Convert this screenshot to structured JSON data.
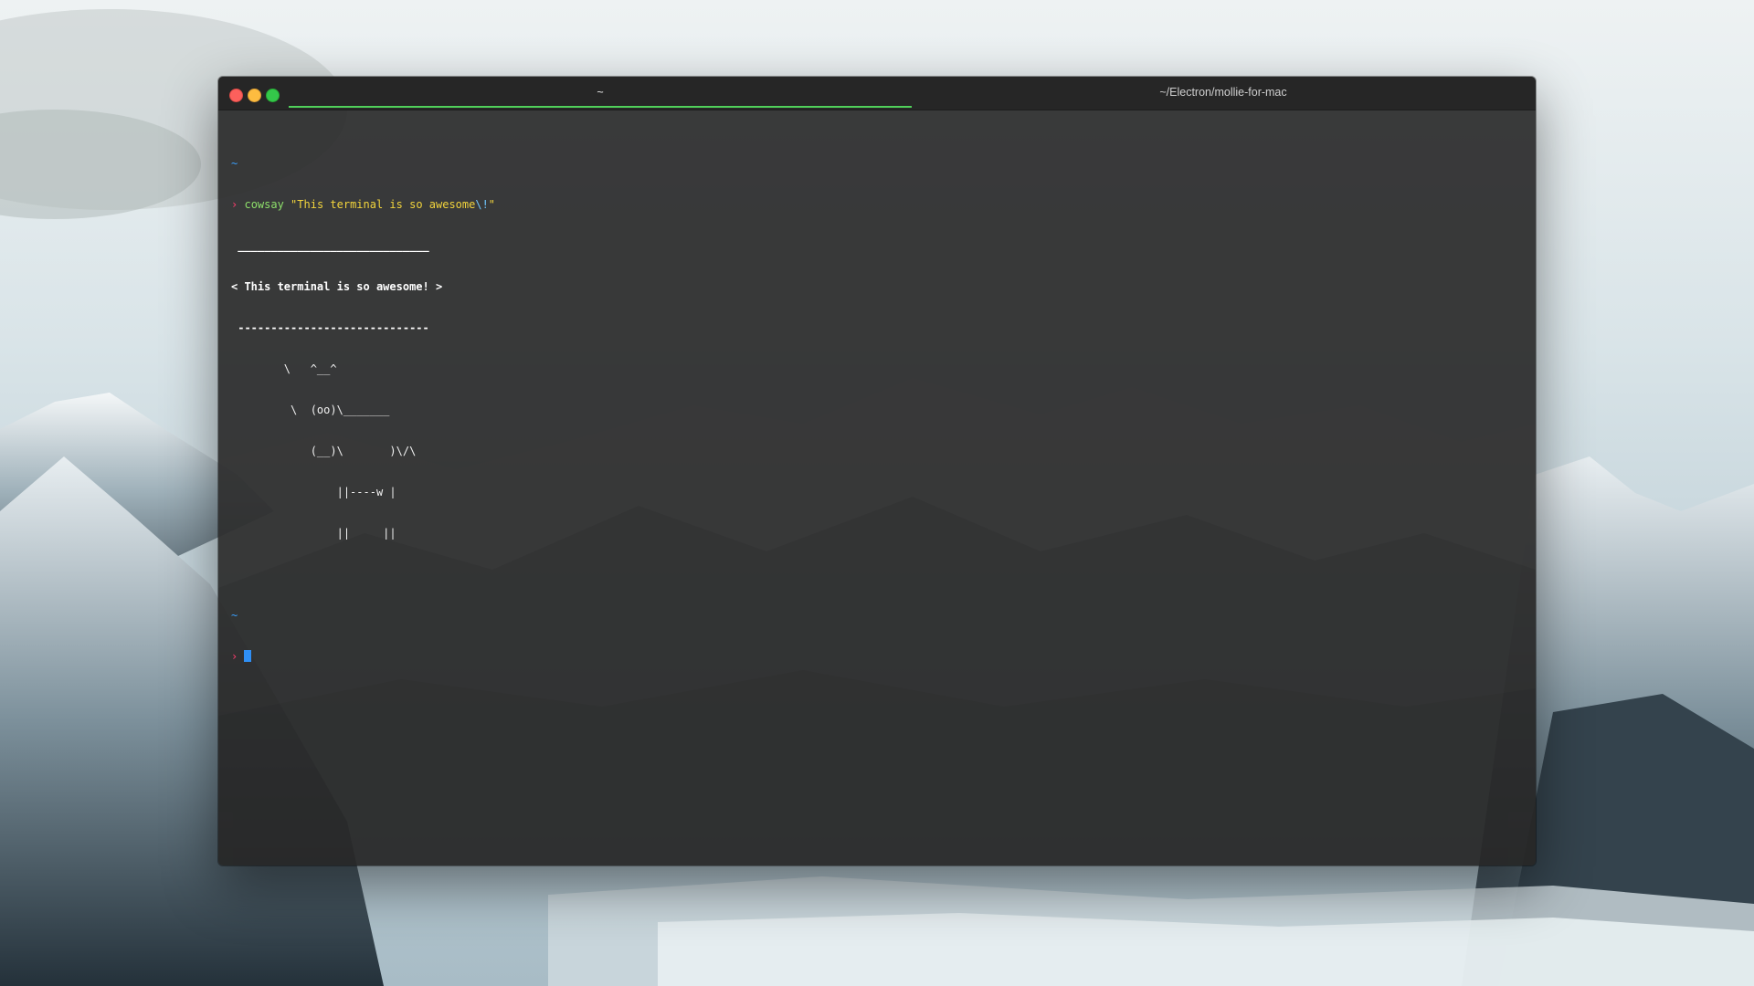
{
  "window": {
    "tabs": [
      {
        "label": "~",
        "active": true
      },
      {
        "label": "~/Electron/mollie-for-mac",
        "active": false
      }
    ],
    "accent_color": "#50d05a"
  },
  "terminal": {
    "prompt_dir": "~",
    "prompt_symbol": "›",
    "command": {
      "name": "cowsay",
      "arg_open": " \"This terminal is so awesome",
      "arg_escape": "\\!",
      "arg_close": "\""
    },
    "output": [
      " _____________________________",
      "< This terminal is so awesome! >",
      " -----------------------------",
      "        \\   ^__^",
      "         \\  (oo)\\_______",
      "            (__)\\       )\\/\\",
      "                ||----w |",
      "                ||     ||"
    ],
    "second_prompt_dir": "~",
    "second_prompt_symbol": "›"
  },
  "colors": {
    "prompt_dir": "#3aa0ff",
    "prompt_symbol": "#ff3d6e",
    "command": "#8ee06b",
    "string": "#f2d43c",
    "cursor": "#2f8ff5"
  }
}
